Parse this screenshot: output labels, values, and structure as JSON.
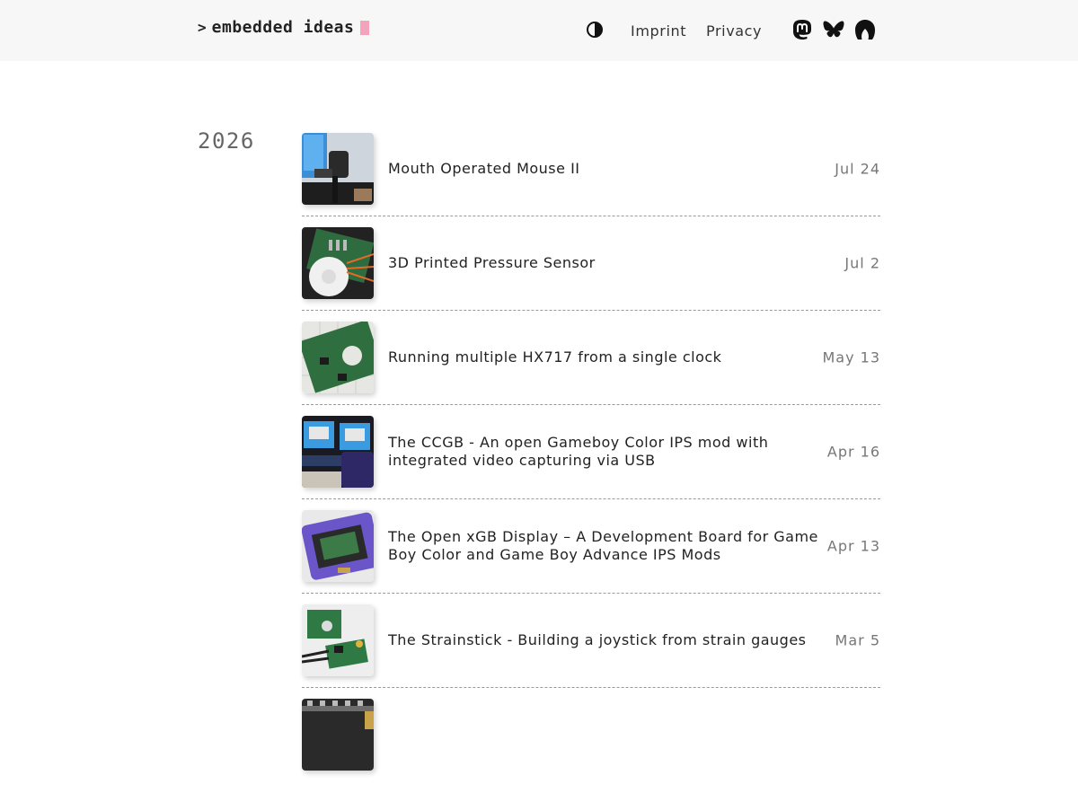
{
  "header": {
    "logo_prompt": ">",
    "logo_text": "embedded ideas",
    "nav": {
      "imprint": "Imprint",
      "privacy": "Privacy"
    },
    "icons": {
      "theme": "contrast-icon",
      "mastodon": "mastodon-icon",
      "bluesky": "bluesky-icon",
      "arena": "arena-icon"
    },
    "cursor_color": "#f4a3bd"
  },
  "archive": {
    "year": "2026",
    "posts": [
      {
        "title": "Mouth Operated Mouse II",
        "date": "Jul 24"
      },
      {
        "title": "3D Printed Pressure Sensor",
        "date": "Jul 2"
      },
      {
        "title": "Running multiple HX717 from a single clock",
        "date": "May 13"
      },
      {
        "title": "The CCGB - An open Gameboy Color IPS mod with integrated video capturing via USB",
        "date": "Apr 16"
      },
      {
        "title": "The Open xGB Display – A Development Board for Game Boy Color and Game Boy Advance IPS Mods",
        "date": "Apr 13"
      },
      {
        "title": "The Strainstick - Building a joystick from strain gauges",
        "date": "Mar 5"
      },
      {
        "title": "",
        "date": ""
      }
    ]
  }
}
